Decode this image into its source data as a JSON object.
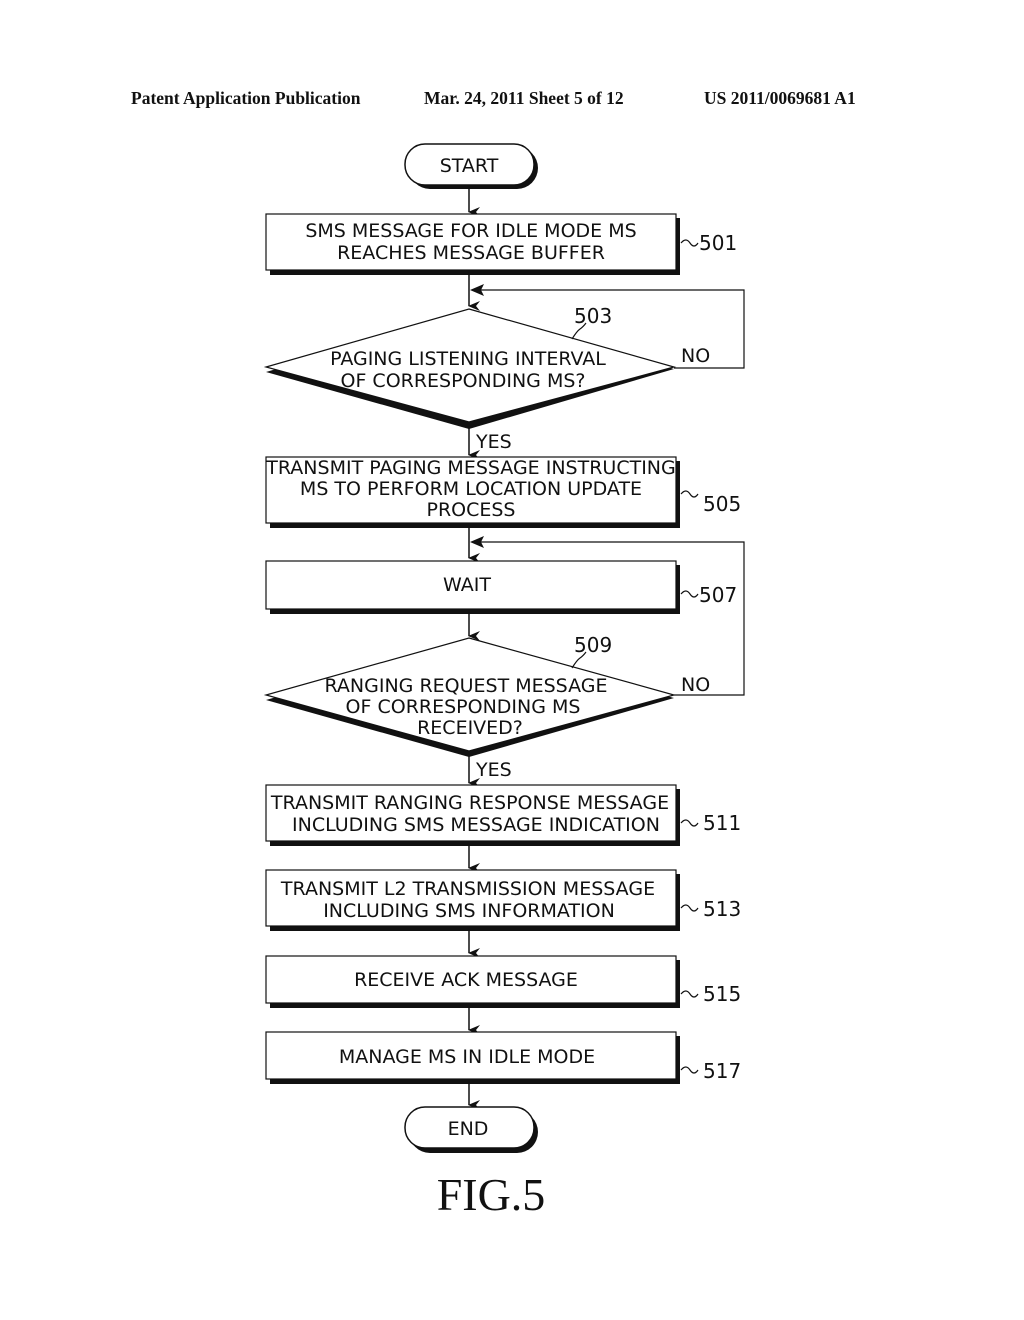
{
  "header": {
    "publication": "Patent Application Publication",
    "date_sheet": "Mar. 24, 2011  Sheet 5 of 12",
    "patent_number": "US 2011/0069681 A1"
  },
  "flowchart": {
    "start": "START",
    "end": "END",
    "steps": {
      "s501": {
        "ref": "501",
        "lines": [
          "SMS MESSAGE FOR IDLE MODE MS",
          "REACHES MESSAGE BUFFER"
        ]
      },
      "s503": {
        "ref": "503",
        "lines": [
          "PAGING LISTENING INTERVAL",
          "OF CORRESPONDING MS?"
        ],
        "yes": "YES",
        "no": "NO"
      },
      "s505": {
        "ref": "505",
        "lines": [
          "TRANSMIT PAGING MESSAGE INSTRUCTING",
          "MS TO PERFORM LOCATION UPDATE",
          "PROCESS"
        ]
      },
      "s507": {
        "ref": "507",
        "lines": [
          "WAIT"
        ]
      },
      "s509": {
        "ref": "509",
        "lines": [
          "RANGING REQUEST MESSAGE",
          "OF CORRESPONDING MS",
          "RECEIVED?"
        ],
        "yes": "YES",
        "no": "NO"
      },
      "s511": {
        "ref": "511",
        "lines": [
          "TRANSMIT RANGING RESPONSE MESSAGE",
          "INCLUDING SMS MESSAGE INDICATION"
        ]
      },
      "s513": {
        "ref": "513",
        "lines": [
          "TRANSMIT L2 TRANSMISSION MESSAGE",
          "INCLUDING SMS INFORMATION"
        ]
      },
      "s515": {
        "ref": "515",
        "lines": [
          "RECEIVE ACK MESSAGE"
        ]
      },
      "s517": {
        "ref": "517",
        "lines": [
          "MANAGE MS IN IDLE MODE"
        ]
      }
    }
  },
  "figure_label": "FIG.5"
}
